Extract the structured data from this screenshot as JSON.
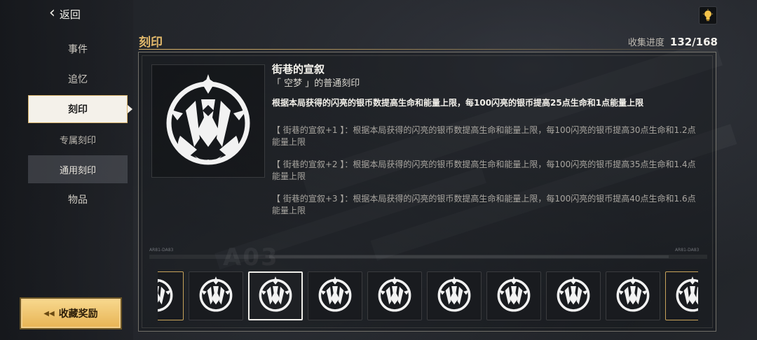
{
  "sidebar": {
    "back_label": "返回",
    "items": [
      {
        "label": "事件"
      },
      {
        "label": "追忆"
      },
      {
        "label": "刻印"
      },
      {
        "label": "专属刻印"
      },
      {
        "label": "通用刻印"
      },
      {
        "label": "物品"
      }
    ],
    "reward_button": "收藏奖励"
  },
  "header": {
    "title": "刻印",
    "progress_label": "收集进度",
    "progress_value": "132/168"
  },
  "detail": {
    "name": "街巷的宣叙",
    "subtitle": "「 空梦 」的普通刻印",
    "description": "根据本局获得的闪亮的银币数提高生命和能量上限，每100闪亮的银币提高25点生命和1点能量上限",
    "tiers": [
      "【 街巷的宣叙+1 】：根据本局获得的闪亮的银币数提高生命和能量上限，每100闪亮的银币提高30点生命和1.2点能量上限",
      "【 街巷的宣叙+2 】：根据本局获得的闪亮的银币数提高生命和能量上限，每100闪亮的银币提高35点生命和1.4点能量上限",
      "【 街巷的宣叙+3 】：根据本局获得的闪亮的银币数提高生命和能量上限，每100闪亮的银币提高40点生命和1.6点能量上限"
    ]
  },
  "strip": {
    "left_code": "AR81-DA83",
    "right_code": "AR81-DA83",
    "big_code": "A03"
  },
  "colors": {
    "accent": "#e2b96b",
    "reward_bg": "#f0c46e"
  },
  "icons": {
    "back": "chevron-left-icon",
    "hint": "lightbulb-icon",
    "imprint": "imprint-emblem-icon"
  }
}
